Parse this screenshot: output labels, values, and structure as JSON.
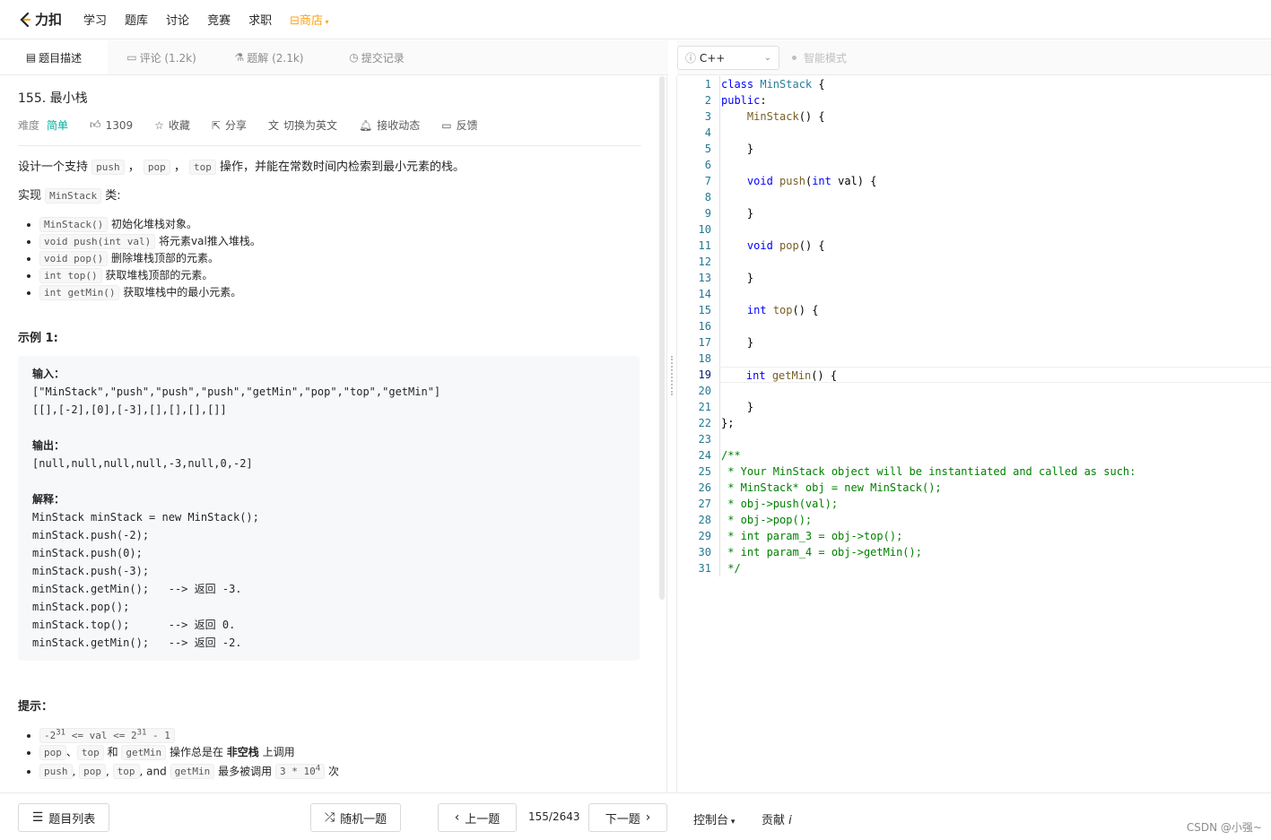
{
  "nav": {
    "logo_text": "力扣",
    "items": [
      "学习",
      "题库",
      "讨论",
      "竞赛",
      "求职"
    ],
    "store": "商店"
  },
  "tabs": [
    {
      "icon": "▤",
      "label": "题目描述"
    },
    {
      "icon": "▭",
      "label": "评论 (1.2k)"
    },
    {
      "icon": "⚗",
      "label": "题解 (2.1k)"
    },
    {
      "icon": "◷",
      "label": "提交记录"
    }
  ],
  "editor": {
    "language": "C++",
    "smart_mode": "智能模式"
  },
  "problem": {
    "title": "155. 最小栈",
    "difficulty_label": "难度",
    "difficulty": "简单",
    "likes": "1309",
    "collect": "收藏",
    "share": "分享",
    "switch_lang": "切换为英文",
    "subscribe": "接收动态",
    "feedback": "反馈",
    "intro": {
      "pre": "设计一个支持 ",
      "c1": "push",
      "s1": " ， ",
      "c2": "pop",
      "s2": " ， ",
      "c3": "top",
      "post": " 操作，并能在常数时间内检索到最小元素的栈。"
    },
    "impl": {
      "pre": "实现 ",
      "code": "MinStack",
      "post": " 类:"
    },
    "methods": [
      {
        "code": "MinStack()",
        "text": " 初始化堆栈对象。"
      },
      {
        "code": "void push(int val)",
        "text": " 将元素val推入堆栈。"
      },
      {
        "code": "void pop()",
        "text": " 删除堆栈顶部的元素。"
      },
      {
        "code": "int top()",
        "text": " 获取堆栈顶部的元素。"
      },
      {
        "code": "int getMin()",
        "text": " 获取堆栈中的最小元素。"
      }
    ],
    "example_title": "示例 1:",
    "example": {
      "input_label": "输入：",
      "input_line1": "[\"MinStack\",\"push\",\"push\",\"push\",\"getMin\",\"pop\",\"top\",\"getMin\"]",
      "input_line2": "[[],[-2],[0],[-3],[],[],[],[]]",
      "output_label": "输出：",
      "output_line": "[null,null,null,null,-3,null,0,-2]",
      "explain_label": "解释：",
      "explain_lines": [
        "MinStack minStack = new MinStack();",
        "minStack.push(-2);",
        "minStack.push(0);",
        "minStack.push(-3);",
        "minStack.getMin();   --> 返回 -3.",
        "minStack.pop();",
        "minStack.top();      --> 返回 0.",
        "minStack.getMin();   --> 返回 -2."
      ]
    },
    "hint_title": "提示：",
    "hints": {
      "h1_a": "-2",
      "h1_exp1": "31",
      "h1_b": " <= val <= 2",
      "h1_exp2": "31",
      "h1_c": " - 1",
      "h2_c1": "pop",
      "h2_s1": "、",
      "h2_c2": "top",
      "h2_s2": " 和 ",
      "h2_c3": "getMin",
      "h2_t1": " 操作总是在 ",
      "h2_bold": "非空栈",
      "h2_t2": " 上调用",
      "h3_c1": "push",
      "h3_s1": ", ",
      "h3_c2": "pop",
      "h3_s2": ", ",
      "h3_c3": "top",
      "h3_s3": ", and ",
      "h3_c4": "getMin",
      "h3_t1": " 最多被调用 ",
      "h3_code": "3 * 10",
      "h3_exp": "4",
      "h3_t2": " 次"
    }
  },
  "code_lines": [
    [
      [
        "kw",
        "class"
      ],
      [
        "pl",
        " "
      ],
      [
        "ty",
        "MinStack"
      ],
      [
        "pl",
        " {"
      ]
    ],
    [
      [
        "kw",
        "public"
      ],
      [
        "pl",
        ":"
      ]
    ],
    [
      [
        "pl",
        "    "
      ],
      [
        "fn",
        "MinStack"
      ],
      [
        "pl",
        "() {"
      ]
    ],
    [
      [
        "pl",
        ""
      ]
    ],
    [
      [
        "pl",
        "    }"
      ]
    ],
    [
      [
        "pl",
        ""
      ]
    ],
    [
      [
        "pl",
        "    "
      ],
      [
        "kw",
        "void"
      ],
      [
        "pl",
        " "
      ],
      [
        "fn",
        "push"
      ],
      [
        "pl",
        "("
      ],
      [
        "kw",
        "int"
      ],
      [
        "pl",
        " val) {"
      ]
    ],
    [
      [
        "pl",
        ""
      ]
    ],
    [
      [
        "pl",
        "    }"
      ]
    ],
    [
      [
        "pl",
        ""
      ]
    ],
    [
      [
        "pl",
        "    "
      ],
      [
        "kw",
        "void"
      ],
      [
        "pl",
        " "
      ],
      [
        "fn",
        "pop"
      ],
      [
        "pl",
        "() {"
      ]
    ],
    [
      [
        "pl",
        ""
      ]
    ],
    [
      [
        "pl",
        "    }"
      ]
    ],
    [
      [
        "pl",
        ""
      ]
    ],
    [
      [
        "pl",
        "    "
      ],
      [
        "kw",
        "int"
      ],
      [
        "pl",
        " "
      ],
      [
        "fn",
        "top"
      ],
      [
        "pl",
        "() {"
      ]
    ],
    [
      [
        "pl",
        ""
      ]
    ],
    [
      [
        "pl",
        "    }"
      ]
    ],
    [
      [
        "pl",
        ""
      ]
    ],
    [
      [
        "pl",
        "    "
      ],
      [
        "kw",
        "int"
      ],
      [
        "pl",
        " "
      ],
      [
        "fn",
        "getMin"
      ],
      [
        "pl",
        "() {"
      ]
    ],
    [
      [
        "pl",
        ""
      ]
    ],
    [
      [
        "pl",
        "    }"
      ]
    ],
    [
      [
        "pl",
        "};"
      ]
    ],
    [
      [
        "pl",
        ""
      ]
    ],
    [
      [
        "cm",
        "/**"
      ]
    ],
    [
      [
        "cm",
        " * Your MinStack object will be instantiated and called as such:"
      ]
    ],
    [
      [
        "cm",
        " * MinStack* obj = new MinStack();"
      ]
    ],
    [
      [
        "cm",
        " * obj->push(val);"
      ]
    ],
    [
      [
        "cm",
        " * obj->pop();"
      ]
    ],
    [
      [
        "cm",
        " * int param_3 = obj->top();"
      ]
    ],
    [
      [
        "cm",
        " * int param_4 = obj->getMin();"
      ]
    ],
    [
      [
        "cm",
        " */"
      ]
    ]
  ],
  "current_line": 19,
  "footer": {
    "problem_list": "题目列表",
    "random": "随机一题",
    "prev": "上一题",
    "page": "155/2643",
    "next": "下一题",
    "console": "控制台",
    "contribute": "贡献",
    "watermark": "CSDN @小强~"
  }
}
